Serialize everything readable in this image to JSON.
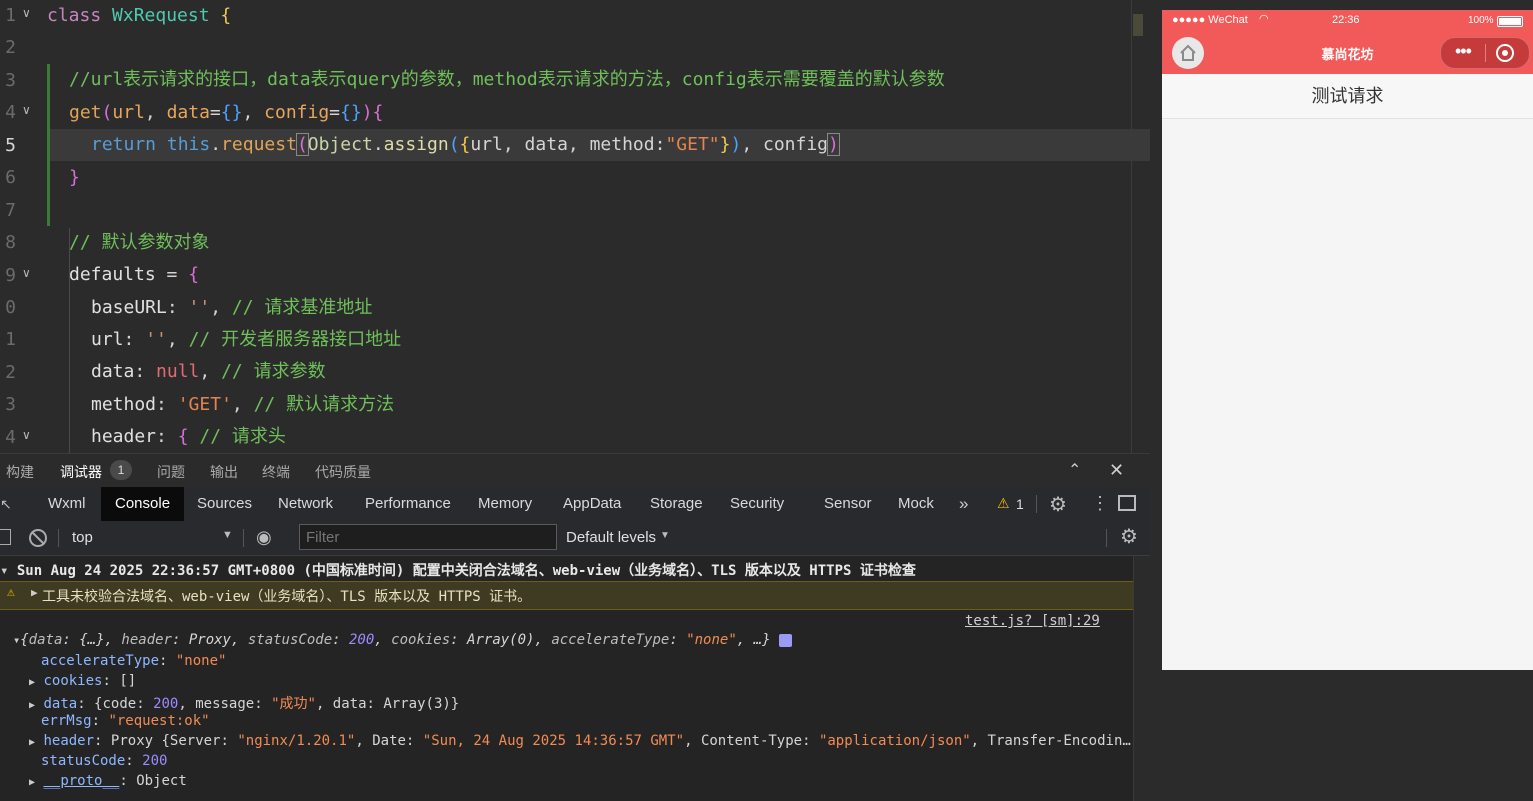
{
  "editor": {
    "line_numbers": [
      "1",
      "2",
      "3",
      "4",
      "5",
      "6",
      "7",
      "8",
      "9",
      "0",
      "1",
      "2",
      "3",
      "4"
    ],
    "lines": {
      "l1_kw": "class",
      "l1_name": "WxRequest",
      "l1_brace": "{",
      "l3_comment": "//url表示请求的接口，data表示query的参数，method表示请求的方法，config表示需要覆盖的默认参数",
      "l4_fn": "get",
      "l4_open": "(",
      "l4_url": "url",
      "l4_c1": ", ",
      "l4_data": "data",
      "l4_eq1": "=",
      "l4_obj1": "{}",
      "l4_c2": ", ",
      "l4_config": "config",
      "l4_eq2": "=",
      "l4_obj2": "{}",
      "l4_close": ")",
      "l4_brace": "{",
      "l5_return": "return",
      "l5_this": "this",
      "l5_dot1": ".",
      "l5_request": "request",
      "l5_p1": "(",
      "l5_object": "Object",
      "l5_dot2": ".",
      "l5_assign": "assign",
      "l5_p2": "(",
      "l5_b1": "{",
      "l5_args": "url, data, method:",
      "l5_get": "\"GET\"",
      "l5_b2": "}",
      "l5_p3": ")",
      "l5_rest": ", config",
      "l5_p4": ")",
      "l6_brace": "}",
      "l8_comment": "// 默认参数对象",
      "l9_name": "defaults",
      "l9_eq": " = ",
      "l9_brace": "{",
      "l10_key": "baseURL",
      "l10_colon": ": ",
      "l10_val": "''",
      "l10_comma": ", ",
      "l10_comment": "// 请求基准地址",
      "l11_key": "url",
      "l11_colon": ": ",
      "l11_val": "''",
      "l11_comma": ", ",
      "l11_comment": "// 开发者服务器接口地址",
      "l12_key": "data",
      "l12_colon": ": ",
      "l12_val": "null",
      "l12_comma": ", ",
      "l12_comment": "// 请求参数",
      "l13_key": "method",
      "l13_colon": ": ",
      "l13_val": "'GET'",
      "l13_comma": ", ",
      "l13_comment": "// 默认请求方法",
      "l14_key": "header",
      "l14_colon": ": ",
      "l14_brace": "{ ",
      "l14_comment": "// 请求头"
    }
  },
  "phone": {
    "carrier": "●●●●● WeChat",
    "time": "22:36",
    "battery": "100%",
    "title": "慕尚花坊",
    "button_label": "测试请求"
  },
  "panel_tabs": [
    "构建",
    "调试器",
    "问题",
    "输出",
    "终端",
    "代码质量"
  ],
  "debugger_badge": "1",
  "devtools_tabs": [
    "Wxml",
    "Console",
    "Sources",
    "Network",
    "Performance",
    "Memory",
    "AppData",
    "Storage",
    "Security",
    "Sensor",
    "Mock"
  ],
  "warning_count": "1",
  "toolbar": {
    "context": "top",
    "filter_placeholder": "Filter",
    "levels": "Default levels"
  },
  "console": {
    "group_header": "Sun Aug 24 2025 22:36:57 GMT+0800 (中国标准时间) 配置中关闭合法域名、web-view（业务域名）、TLS 版本以及 HTTPS 证书检查",
    "warning": "工具未校验合法域名、web-view（业务域名）、TLS 版本以及 HTTPS 证书。",
    "source_link": "test.js? [sm]:29",
    "summary": {
      "open": "{",
      "k1": "data",
      "v1": ": {…}, ",
      "k2": "header",
      "v2": ": Proxy, ",
      "k3": "statusCode",
      "v3": "200",
      "s3": ", ",
      "k4": "cookies",
      "v4": ": Array(0), ",
      "k5": "accelerateType",
      "v5": "\"none\"",
      "close": ", …}"
    },
    "props": {
      "accel_key": "accelerateType",
      "accel_val": "\"none\"",
      "cookies_key": "cookies",
      "cookies_val": "[]",
      "data_key": "data",
      "data_pre": "{code: ",
      "data_code": "200",
      "data_mid": ", message: ",
      "data_msg": "\"成功\"",
      "data_post": ", data: Array(3)}",
      "errmsg_key": "errMsg",
      "errmsg_val": "\"request:ok\"",
      "header_key": "header",
      "header_pre": "Proxy {Server: ",
      "header_server": "\"nginx/1.20.1\"",
      "header_mid": ", Date: ",
      "header_date": "\"Sun, 24 Aug 2025 14:36:57 GMT\"",
      "header_mid2": ", Content-Type: ",
      "header_ct": "\"application/json\"",
      "header_post": ", Transfer-Encodin…",
      "status_key": "statusCode",
      "status_val": "200",
      "proto_key": "__proto__",
      "proto_val": "Object"
    }
  }
}
